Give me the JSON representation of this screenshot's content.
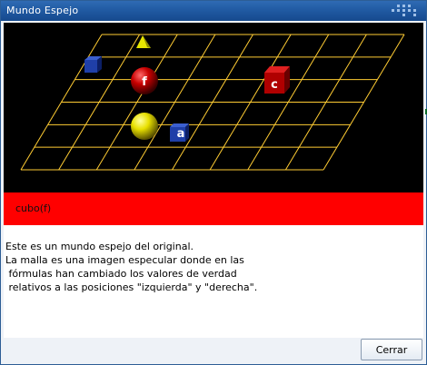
{
  "window": {
    "title": "Mundo Espejo"
  },
  "scene": {
    "grid_color": "#ffcc33",
    "objects": [
      {
        "id": "cube-c",
        "label": "c"
      },
      {
        "id": "ball-f",
        "label": "f"
      },
      {
        "id": "cube-a",
        "label": "a"
      }
    ]
  },
  "formula": {
    "text": "cubo(f)",
    "bar_color": "#ff0000"
  },
  "description": {
    "lines": [
      "Este es un mundo espejo del original.",
      "La malla es una imagen especular donde en las",
      " fórmulas han cambiado los valores de verdad",
      " relativos a las posiciones \"izquierda\" y \"derecha\"."
    ]
  },
  "buttons": {
    "close_label": "Cerrar"
  }
}
